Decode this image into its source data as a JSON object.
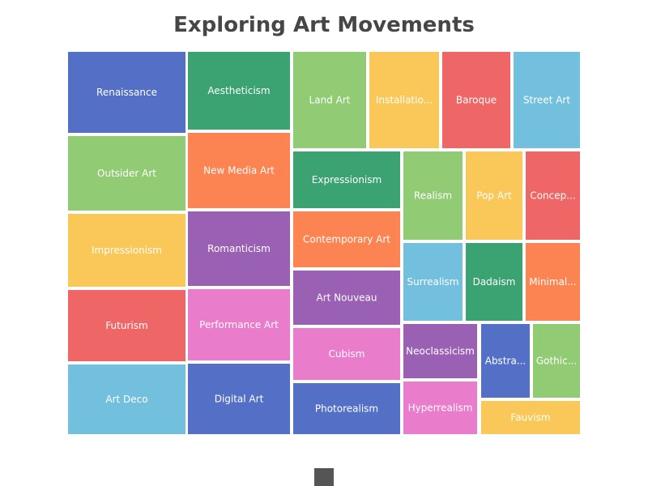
{
  "chart_data": {
    "type": "treemap",
    "title": "Exploring Art Movements",
    "palette": [
      "#5470c6",
      "#3ba272",
      "#91cc75",
      "#fac858",
      "#ee6666",
      "#73c0de",
      "#fc8452",
      "#9a60b4",
      "#ea7ccc"
    ],
    "items": [
      {
        "name": "Renaissance",
        "label": "Renaissance",
        "value": 10,
        "color": "#5470c6"
      },
      {
        "name": "Outsider Art",
        "label": "Outsider Art",
        "value": 9,
        "color": "#91cc75"
      },
      {
        "name": "Impressionism",
        "label": "Impressionism",
        "value": 9,
        "color": "#fac858"
      },
      {
        "name": "Futurism",
        "label": "Futurism",
        "value": 9,
        "color": "#ee6666"
      },
      {
        "name": "Art Deco",
        "label": "Art Deco",
        "value": 9,
        "color": "#73c0de"
      },
      {
        "name": "Aestheticism",
        "label": "Aestheticism",
        "value": 8,
        "color": "#3ba272"
      },
      {
        "name": "New Media Art",
        "label": "New Media Art",
        "value": 8,
        "color": "#fc8452"
      },
      {
        "name": "Romanticism",
        "label": "Romanticism",
        "value": 8,
        "color": "#9a60b4"
      },
      {
        "name": "Performance Art",
        "label": "Performance Art",
        "value": 8,
        "color": "#ea7ccc"
      },
      {
        "name": "Digital Art",
        "label": "Digital Art",
        "value": 8,
        "color": "#5470c6"
      },
      {
        "name": "Land Art",
        "label": "Land Art",
        "value": 7,
        "color": "#91cc75"
      },
      {
        "name": "Installation Art",
        "label": "Installatio...",
        "value": 7,
        "color": "#fac858"
      },
      {
        "name": "Baroque",
        "label": "Baroque",
        "value": 7,
        "color": "#ee6666"
      },
      {
        "name": "Street Art",
        "label": "Street Art",
        "value": 7,
        "color": "#73c0de"
      },
      {
        "name": "Expressionism",
        "label": "Expressionism",
        "value": 7,
        "color": "#3ba272"
      },
      {
        "name": "Contemporary Art",
        "label": "Contemporary Art",
        "value": 7,
        "color": "#fc8452"
      },
      {
        "name": "Art Nouveau",
        "label": "Art Nouveau",
        "value": 7,
        "color": "#9a60b4"
      },
      {
        "name": "Cubism",
        "label": "Cubism",
        "value": 7,
        "color": "#ea7ccc"
      },
      {
        "name": "Photorealism",
        "label": "Photorealism",
        "value": 7,
        "color": "#5470c6"
      },
      {
        "name": "Realism",
        "label": "Realism",
        "value": 6,
        "color": "#91cc75"
      },
      {
        "name": "Pop Art",
        "label": "Pop Art",
        "value": 6,
        "color": "#fac858"
      },
      {
        "name": "Conceptual Art",
        "label": "Concep...",
        "value": 6,
        "color": "#ee6666"
      },
      {
        "name": "Surrealism",
        "label": "Surrealism",
        "value": 6,
        "color": "#73c0de"
      },
      {
        "name": "Dadaism",
        "label": "Dadaism",
        "value": 6,
        "color": "#3ba272"
      },
      {
        "name": "Minimalism",
        "label": "Minimal...",
        "value": 6,
        "color": "#fc8452"
      },
      {
        "name": "Neoclassicism",
        "label": "Neoclassicism",
        "value": 6,
        "color": "#9a60b4"
      },
      {
        "name": "Hyperrealism",
        "label": "Hyperrealism",
        "value": 6,
        "color": "#ea7ccc"
      },
      {
        "name": "Abstract Art",
        "label": "Abstra...",
        "value": 5,
        "color": "#5470c6"
      },
      {
        "name": "Gothic Art",
        "label": "Gothic...",
        "value": 5,
        "color": "#91cc75"
      },
      {
        "name": "Fauvism",
        "label": "Fauvism",
        "value": 4,
        "color": "#fac858"
      }
    ],
    "legend": {
      "marker_color": "#555555"
    }
  }
}
